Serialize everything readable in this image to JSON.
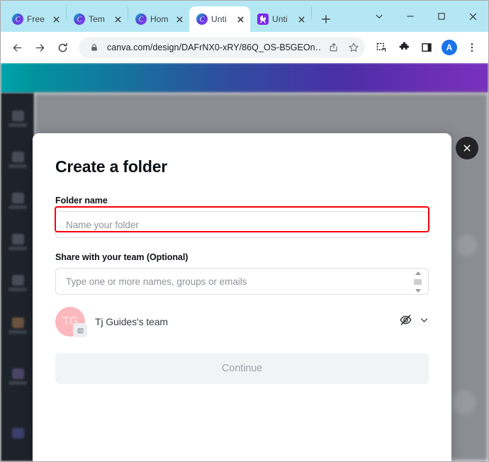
{
  "browser": {
    "tabs": [
      {
        "title": "Free",
        "icon": "canva-icon",
        "active": false
      },
      {
        "title": "Tem",
        "icon": "canva-icon",
        "active": false
      },
      {
        "title": "Hom",
        "icon": "canva-icon",
        "active": false
      },
      {
        "title": "Unti",
        "icon": "canva-icon",
        "active": true
      },
      {
        "title": "Unti",
        "icon": "canva-design-icon",
        "active": false
      }
    ],
    "new_tab_label": "+",
    "window_controls": {
      "tab_search": "tab-search-chevron",
      "minimize": "minimize",
      "maximize": "maximize",
      "close": "close"
    },
    "toolbar": {
      "back": "back-arrow",
      "forward": "forward-arrow",
      "reload": "reload",
      "url": "canva.com/design/DAFrNX0-xRY/86Q_OS-B5GEOn…",
      "lock_icon": "lock-icon",
      "share_icon": "share-icon",
      "bookmark_icon": "star-icon",
      "reading_list_icon": "reading-list-icon",
      "extensions_icon": "puzzle-icon",
      "side_panel_icon": "side-panel-icon",
      "profile_initial": "A",
      "menu_icon": "kebab-menu-icon"
    }
  },
  "modal": {
    "title": "Create a folder",
    "folder_name": {
      "label": "Folder name",
      "placeholder": "Name your folder",
      "value": "",
      "highlighted": true,
      "highlight_color": "#fb0007"
    },
    "share": {
      "label": "Share with your team (Optional)",
      "placeholder": "Type one or more names, groups or emails",
      "value": ""
    },
    "team": {
      "initials": "TG",
      "name": "Tj Guides's team",
      "avatar_color": "#fbb8bd",
      "badge_icon": "building-icon",
      "permission_icon": "eye-slash-icon",
      "permission_chevron": "chevron-down-icon"
    },
    "continue_button": {
      "label": "Continue",
      "disabled": true
    },
    "close_button": "close-icon"
  },
  "background": {
    "app": "canva-editor",
    "sidebar_items": [
      {
        "label": "Design"
      },
      {
        "label": "Elements"
      },
      {
        "label": "Uploads"
      },
      {
        "label": "Projects"
      },
      {
        "label": "Text"
      },
      {
        "label": "Brand"
      },
      {
        "label": "Apps"
      }
    ]
  }
}
